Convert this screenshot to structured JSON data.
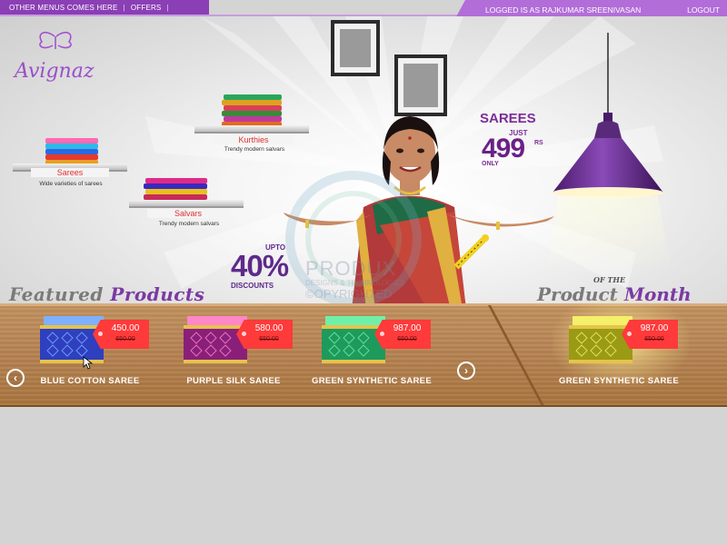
{
  "topbar": {
    "menu_link": "OTHER MENUS COMES HERE",
    "separator": "|",
    "offers_link": "OFFERS",
    "logged_in_text": "LOGGED IS AS RAJKUMAR SREENIVASAN",
    "logout_link": "LOGOUT"
  },
  "brand": {
    "logo_text": "Avignaz"
  },
  "shelves": [
    {
      "label": "Sarees",
      "subtitle": "Wide varieties of sarees"
    },
    {
      "label": "Kurthies",
      "subtitle": "Trendy modern salvars"
    },
    {
      "label": "Salvars",
      "subtitle": "Trendy modern salvars"
    }
  ],
  "promo": {
    "title": "SAREES",
    "just": "JUST",
    "price": "499",
    "currency": "RS",
    "only": "ONLY"
  },
  "discount": {
    "upto": "UPTO",
    "percent": "40%",
    "label": "DISCOUNTS"
  },
  "watermark": {
    "line1": "PRODUX",
    "line2": "DESIGNS & TECHNOLOGIES",
    "line3": "©OPYRIGHTED"
  },
  "featured": {
    "heading_part1": "Featured",
    "heading_part2": "Products",
    "items": [
      {
        "name": "BLUE COTTON SAREE",
        "price": "450.00",
        "old_price": "650.00",
        "color": "#2e3fbf",
        "accent": "#7fb0ff"
      },
      {
        "name": "PURPLE SILK SAREE",
        "price": "580.00",
        "old_price": "650.00",
        "color": "#8a1f7a",
        "accent": "#ff86c8"
      },
      {
        "name": "GREEN SYNTHETIC SAREE",
        "price": "987.00",
        "old_price": "650.00",
        "color": "#1e9a5c",
        "accent": "#6ff0a8"
      }
    ],
    "prev_icon": "‹",
    "next_icon": "›"
  },
  "product_of_month": {
    "heading_part1": "Product",
    "heading_of_the": "OF THE",
    "heading_part2": "Month",
    "item": {
      "name": "GREEN SYNTHETIC SAREE",
      "price": "987.00",
      "old_price": "650.00",
      "color": "#9a9a14",
      "accent": "#f4f06a"
    }
  },
  "colors": {
    "brand_purple": "#8a3fb5",
    "tag_red": "#ff3a3a",
    "wood": "#b98656"
  }
}
